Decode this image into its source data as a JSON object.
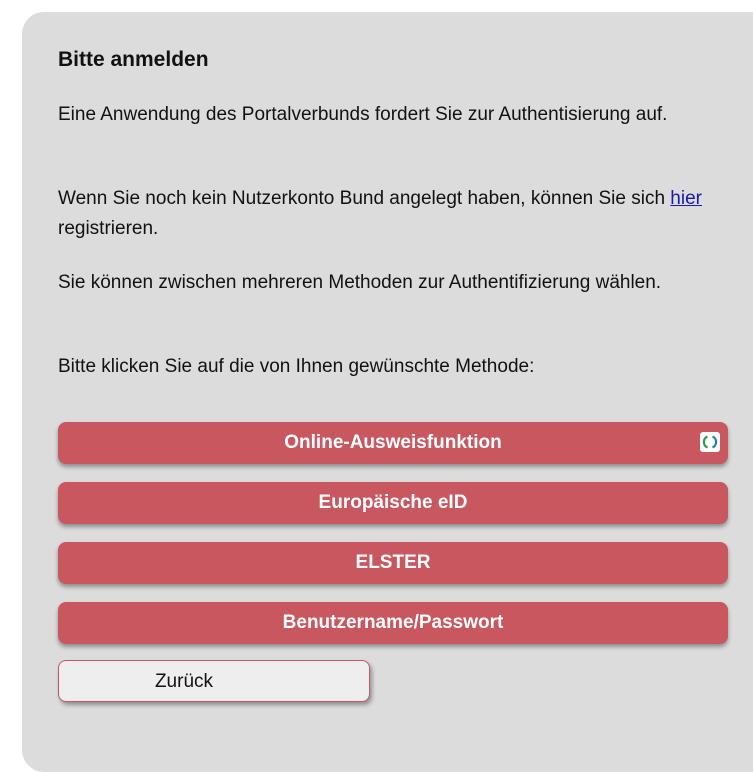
{
  "heading": "Bitte anmelden",
  "paragraphs": {
    "intro": "Eine Anwendung des Portalverbunds fordert Sie zur Authentisierung auf.",
    "register_before": "Wenn Sie noch kein Nutzerkonto Bund angelegt haben, können Sie sich ",
    "register_link": "hier",
    "register_after": " registrieren.",
    "methods_info": "Sie können zwischen mehreren Methoden zur Authentifizierung wählen.",
    "choose": "Bitte klicken Sie auf die von Ihnen gewünschte Methode:"
  },
  "methods": {
    "online_id": "Online-Ausweisfunktion",
    "eu_eid": "Europäische eID",
    "elster": "ELSTER",
    "userpass": "Benutzername/Passwort"
  },
  "back_label": "Zurück",
  "colors": {
    "panel": "#dcdcdc",
    "method_button": "#c8575f",
    "link": "#1a1aa6"
  },
  "icons": {
    "online_id_badge": "eid-logo-icon"
  }
}
